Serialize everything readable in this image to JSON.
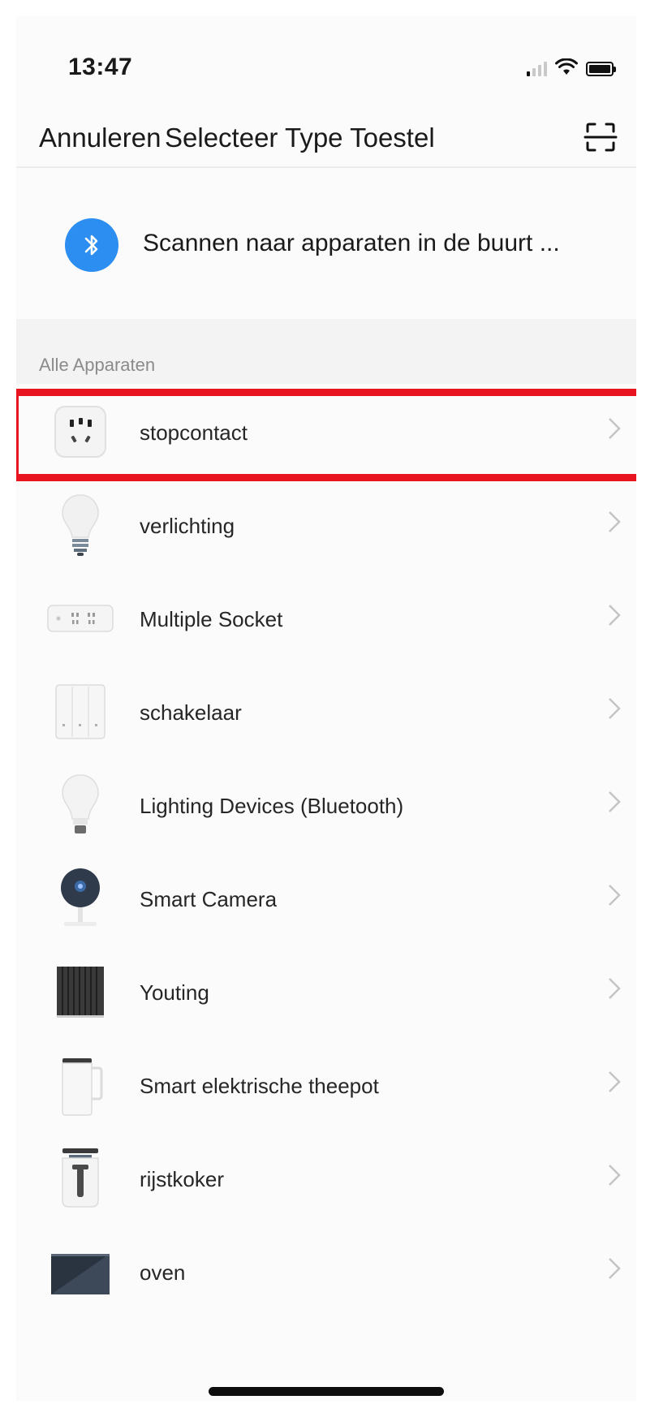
{
  "status_bar": {
    "time": "13:47",
    "signal_bars_active": 1,
    "signal_bars_total": 4,
    "wifi_icon": "wifi-icon",
    "battery_icon": "battery-icon"
  },
  "header": {
    "cancel_label": "Annuleren",
    "title": "Selecteer Type Toestel",
    "scan_icon": "scan-icon"
  },
  "bluetooth": {
    "icon": "bluetooth-icon",
    "icon_color": "#2b8ef0",
    "text": "Scannen naar apparaten in de buurt ..."
  },
  "section": {
    "label": "Alle Apparaten"
  },
  "devices": [
    {
      "label": "stopcontact",
      "icon": "plug-socket-icon",
      "highlighted": true
    },
    {
      "label": "verlichting",
      "icon": "light-bulb-icon"
    },
    {
      "label": "Multiple Socket",
      "icon": "power-strip-icon"
    },
    {
      "label": "schakelaar",
      "icon": "wall-switch-icon"
    },
    {
      "label": "Lighting Devices (Bluetooth)",
      "icon": "bluetooth-bulb-icon"
    },
    {
      "label": "Smart Camera",
      "icon": "camera-icon"
    },
    {
      "label": "Youting",
      "icon": "radiator-icon"
    },
    {
      "label": "Smart elektrische theepot",
      "icon": "kettle-icon"
    },
    {
      "label": "rijstkoker",
      "icon": "rice-cooker-icon"
    },
    {
      "label": "oven",
      "icon": "oven-icon"
    }
  ],
  "colors": {
    "highlight": "#e8141f",
    "accent": "#2b8ef0"
  }
}
